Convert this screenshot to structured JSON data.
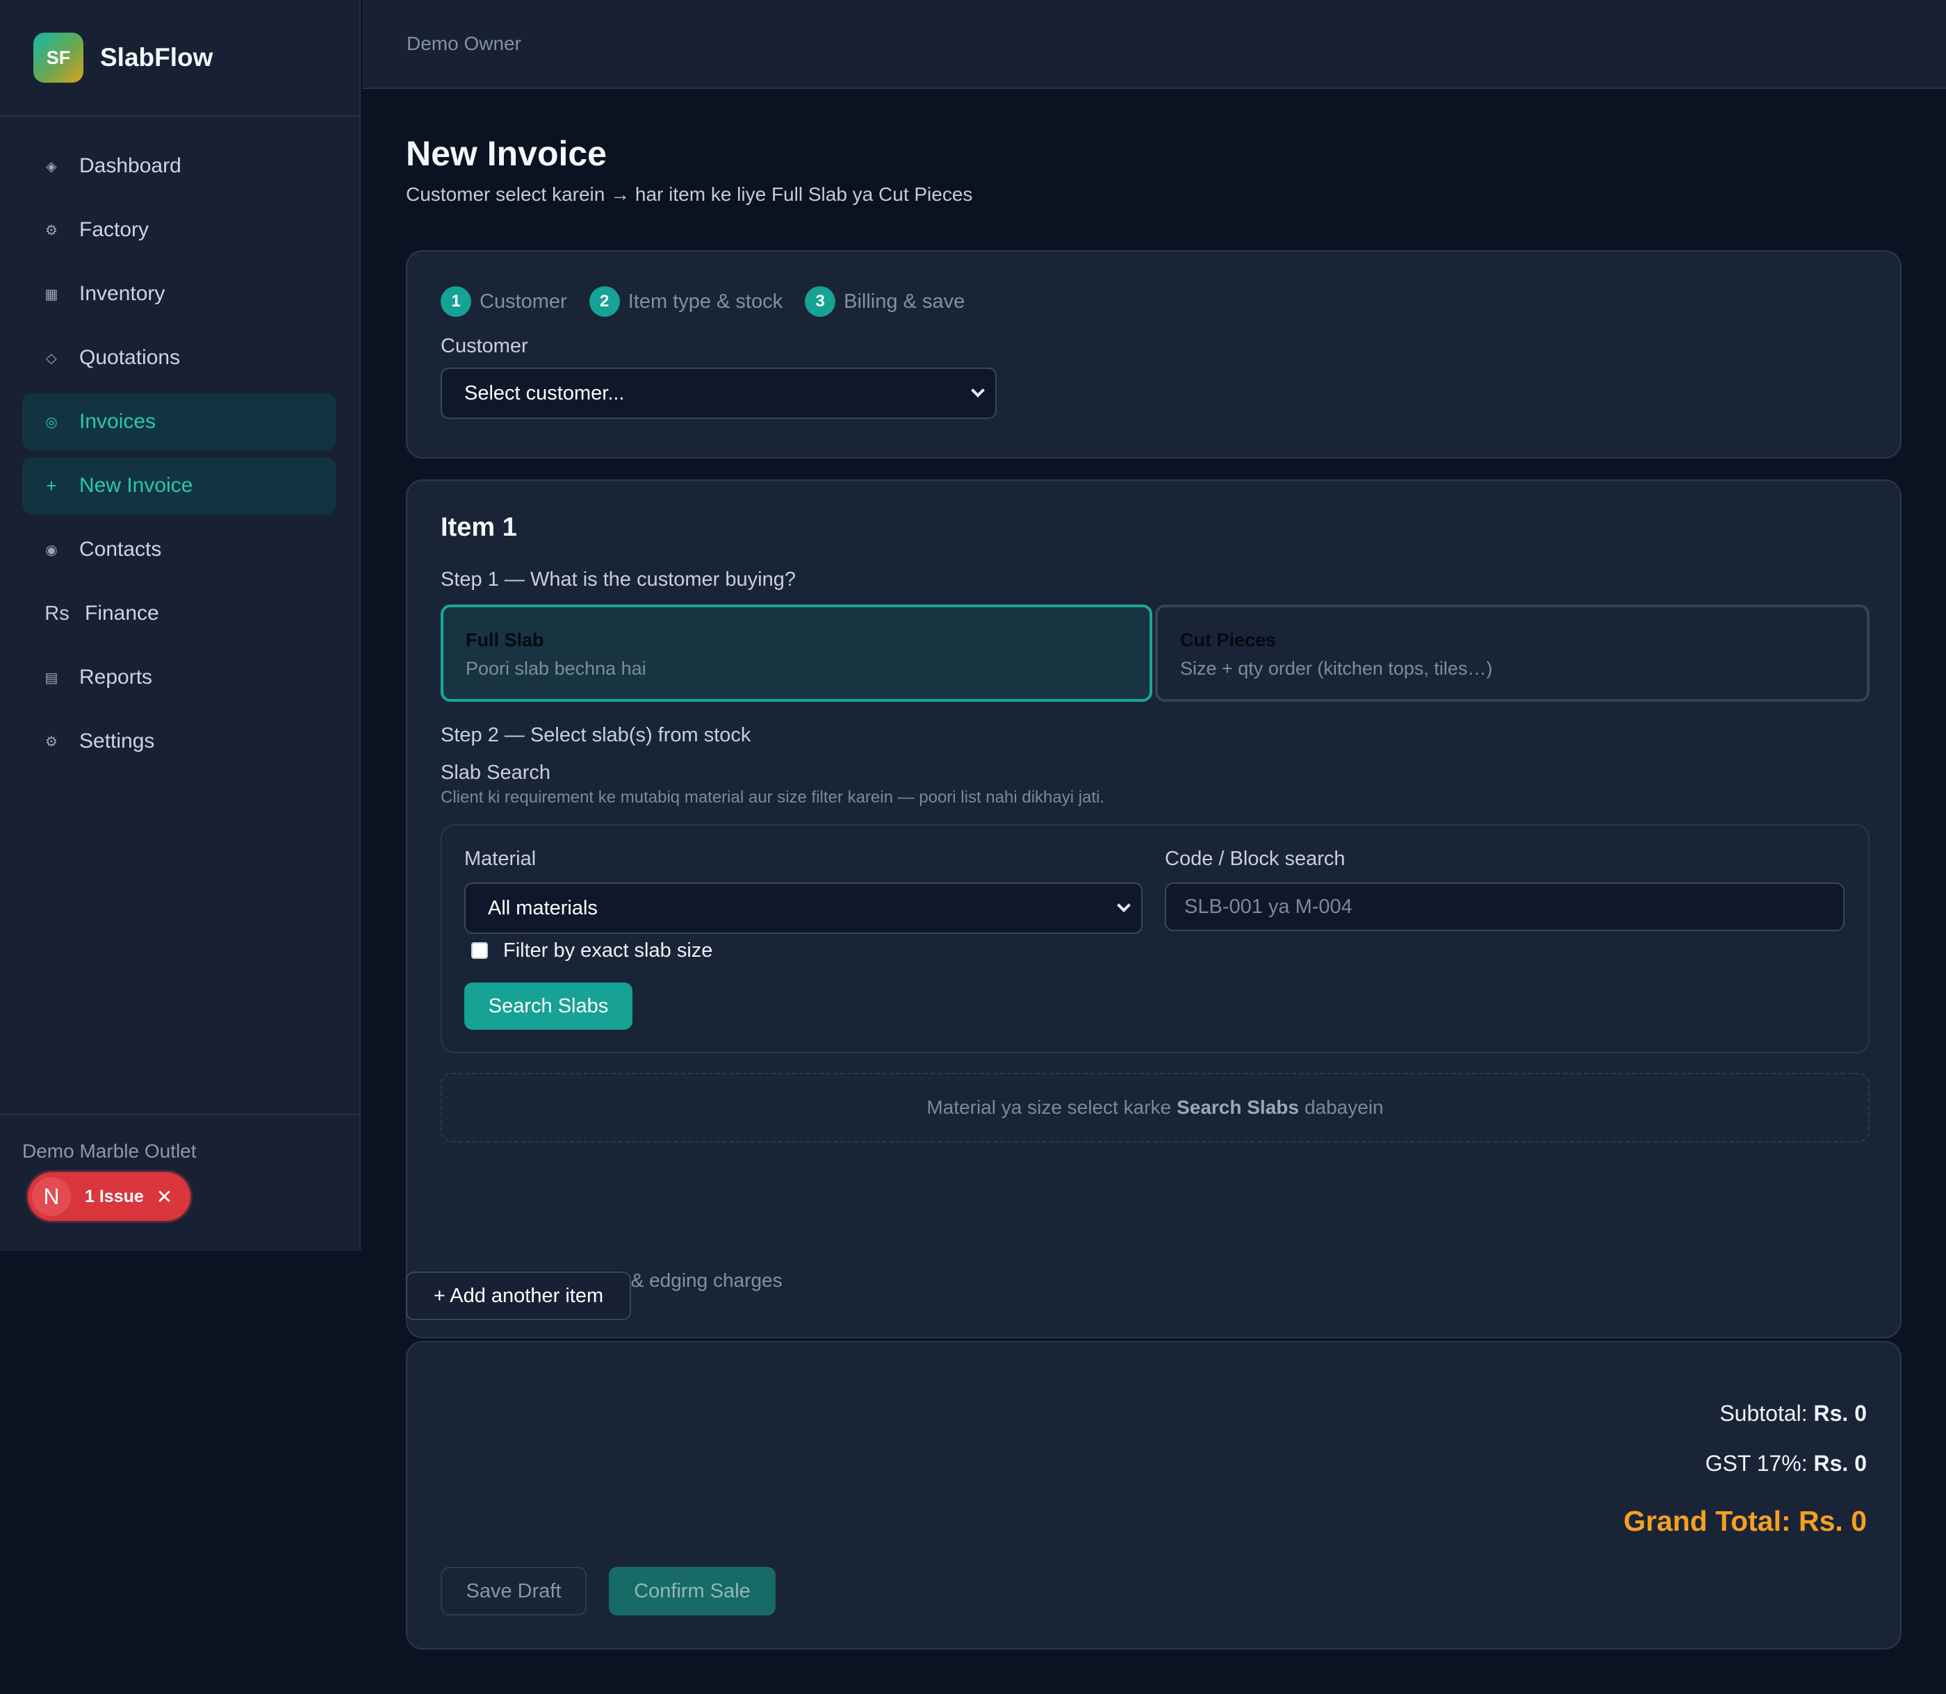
{
  "brand": {
    "logo_text": "SF",
    "name": "SlabFlow"
  },
  "topbar": {
    "user": "Demo Owner"
  },
  "sidebar": {
    "items": [
      {
        "icon": "diamond-dot-icon",
        "glyph": "◈",
        "label": "Dashboard"
      },
      {
        "icon": "gear-icon",
        "glyph": "⚙",
        "label": "Factory"
      },
      {
        "icon": "grid-icon",
        "glyph": "▦",
        "label": "Inventory"
      },
      {
        "icon": "diamond-icon",
        "glyph": "◇",
        "label": "Quotations"
      },
      {
        "icon": "target-icon",
        "glyph": "◎",
        "label": "Invoices"
      },
      {
        "icon": "plus-icon",
        "glyph": "+",
        "label": "New Invoice"
      },
      {
        "icon": "radio-icon",
        "glyph": "◉",
        "label": "Contacts"
      },
      {
        "icon": "rupee-icon",
        "glyph": "Rs",
        "label": "Finance"
      },
      {
        "icon": "list-icon",
        "glyph": "▤",
        "label": "Reports"
      },
      {
        "icon": "gear-icon",
        "glyph": "⚙",
        "label": "Settings"
      }
    ],
    "org_name": "Demo Marble Outlet",
    "issue_badge": {
      "initial": "N",
      "label": "1 Issue",
      "close": "✕"
    }
  },
  "page": {
    "title": "New Invoice",
    "subtitle": "Customer select karein → har item ke liye Full Slab ya Cut Pieces"
  },
  "steps": [
    {
      "num": "1",
      "label": "Customer"
    },
    {
      "num": "2",
      "label": "Item type & stock"
    },
    {
      "num": "3",
      "label": "Billing & save"
    }
  ],
  "customer": {
    "label": "Customer",
    "selected": "Select customer..."
  },
  "item": {
    "title": "Item 1",
    "step1_label": "Step 1 — What is the customer buying?",
    "options": [
      {
        "title": "Full Slab",
        "desc": "Poori slab bechna hai",
        "selected": true
      },
      {
        "title": "Cut Pieces",
        "desc": "Size + qty order (kitchen tops, tiles…)",
        "selected": false
      }
    ],
    "step2_label": "Step 2 — Select slab(s) from stock",
    "slab_search": {
      "title": "Slab Search",
      "hint": "Client ki requirement ke mutabiq material aur size filter karein — poori list nahi dikhayi jati.",
      "material_label": "Material",
      "material_selected": "All materials",
      "code_label": "Code / Block search",
      "code_placeholder": "SLB-001 ya M-004",
      "exact_size_label": "Filter by exact slab size",
      "exact_size_checked": false,
      "search_button": "Search Slabs"
    },
    "empty_state": {
      "before": "Material ya size select karke",
      "bold": "Search Slabs",
      "after": "dabayein"
    },
    "optional_toggle": "▶ Optional — Cutting & edging charges"
  },
  "add_item_button": "+ Add another item",
  "totals": {
    "subtotal_label": "Subtotal:",
    "subtotal_value": "Rs. 0",
    "gst_label": "GST 17%:",
    "gst_value": "Rs. 0",
    "grand_total": "Grand Total: Rs. 0"
  },
  "actions": {
    "save_draft": "Save Draft",
    "confirm": "Confirm Sale"
  },
  "colors": {
    "accent": "#16a294",
    "grand_total": "#f5a020",
    "issue": "#d9363e"
  }
}
